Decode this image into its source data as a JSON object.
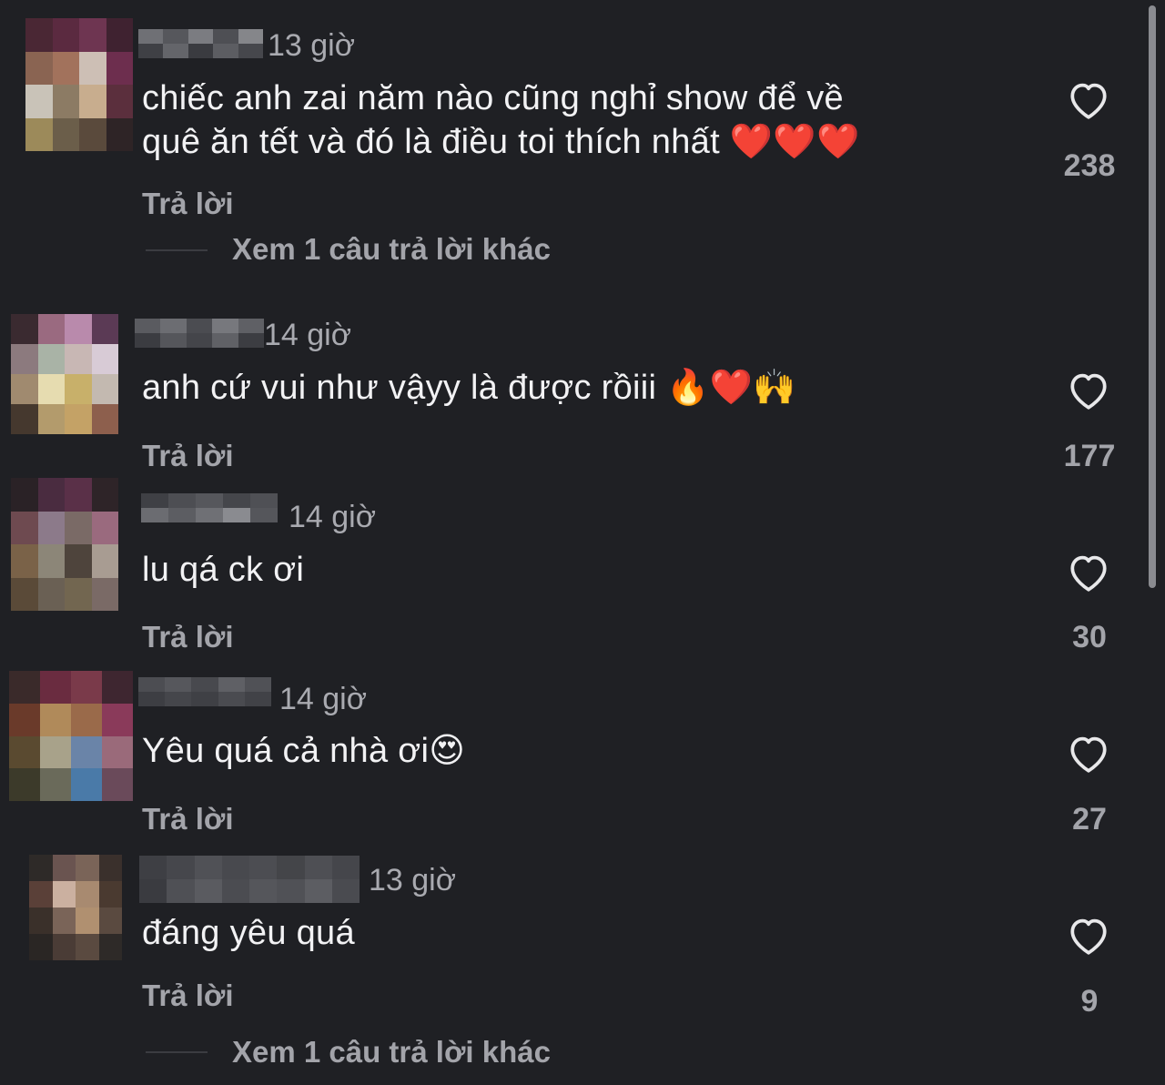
{
  "comments": [
    {
      "time": "13 giờ",
      "text": [
        "chiếc anh zai năm nào cũng nghỉ show để về",
        "quê ăn tết và đó là điều toi thích nhất ❤️❤️❤️"
      ],
      "reply": "Trả lời",
      "likes": "238",
      "more_replies": "Xem 1 câu trả lời khác"
    },
    {
      "time": "14 giờ",
      "text": [
        "anh cứ vui như vậyy là được rồiii 🔥❤️🙌"
      ],
      "reply": "Trả lời",
      "likes": "177"
    },
    {
      "time": "14 giờ",
      "text": [
        "lu qá ck ơi"
      ],
      "reply": "Trả lời",
      "likes": "30"
    },
    {
      "time": "14 giờ",
      "text": [
        "Yêu quá cả nhà ơi😍"
      ],
      "reply": "Trả lời",
      "likes": "27"
    },
    {
      "time": "13 giờ",
      "text": [
        "đáng yêu quá"
      ],
      "reply": "Trả lời",
      "likes": "9",
      "more_replies": "Xem 1 câu trả lời khác"
    }
  ],
  "icons": {
    "like": "heart-outline-icon"
  },
  "colors": {
    "background": "#1f2024",
    "text": "#f2f2f4",
    "muted": "#a3a4aa"
  }
}
